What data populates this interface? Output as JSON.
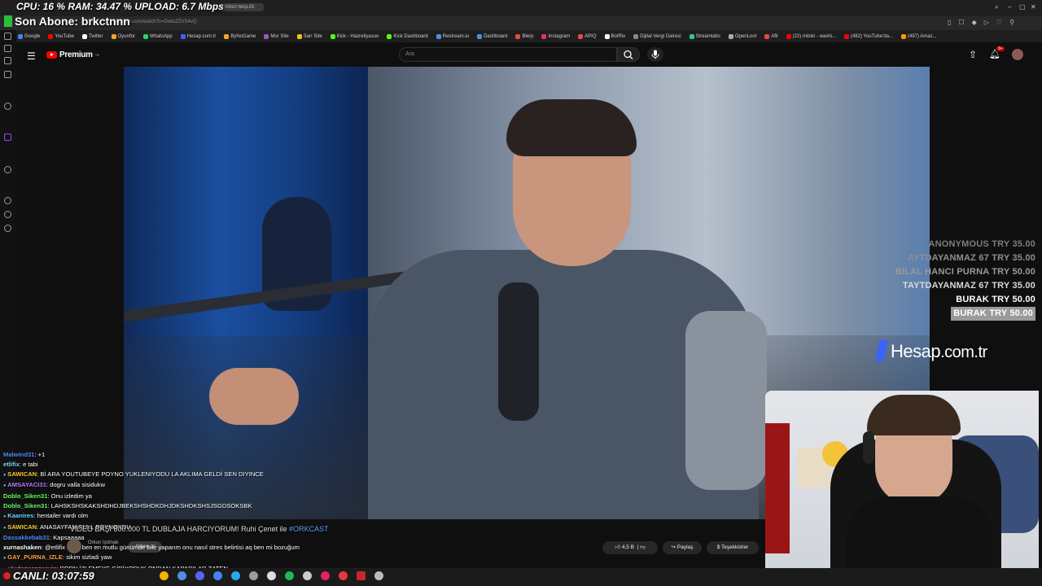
{
  "overlay": {
    "stats": "CPU: 16 % RAM:  34.47 % UPLOAD: 6.7 Mbps",
    "last_sub_prefix": "Son Abone:",
    "last_sub_name": "brkctnnn",
    "live_label": "CANLI:",
    "live_time": "03:07:59",
    "brand": "Hesap",
    "brand_suffix": ".com.tr"
  },
  "browser": {
    "url": "youtube.com/watch?v=DwtuZZVS4vQ",
    "tab_title": "VİDEO BAŞLIĞI",
    "bookmarks": [
      "Google",
      "YouTube",
      "Twitter",
      "Oyunfor",
      "WhatsApp",
      "Hesap.com.tr",
      "ByNoGame",
      "Mor Site",
      "Sarı Site",
      "Kick - Hazretiyasuo",
      "Kick Dashboard",
      "Restream.io",
      "Dashboard",
      "Blerp",
      "Instagram",
      "APIQ",
      "BotRix",
      "Dijital Vergi Dairesi",
      "Streamlabs",
      "OpenLoot",
      "Afil",
      "(22) mitski - washi...",
      "(482) YouTube'da...",
      "(497) Amaz..."
    ],
    "bookmark_colors": [
      "#4285f4",
      "#ff0000",
      "#ffffff",
      "#f5a623",
      "#25d366",
      "#3a63ff",
      "#f5a623",
      "#9b59b6",
      "#f1c40f",
      "#53fc18",
      "#53fc18",
      "#4a90e2",
      "#4a90e2",
      "#e74c3c",
      "#e1306c",
      "#e74c3c",
      "#ffffff",
      "#888888",
      "#31c3a2",
      "#aaaaaa",
      "#e74c3c",
      "#ff0000",
      "#ff0000",
      "#ff9900"
    ]
  },
  "youtube": {
    "logo_text": "Premium",
    "logo_sup": "TR",
    "search_placeholder": "Ara",
    "notif_count": "9+",
    "likes": "4,5 B",
    "share_label": "Paylaş",
    "thanks_label": "Teşekkürler",
    "subscribe_label": "Abone ol",
    "channel_sub": "Orkun Işıtmak"
  },
  "donations": [
    {
      "name": "ANONYMOUS",
      "amount": "TRY 35.00",
      "color": "#7d7d7d"
    },
    {
      "name": "AYTDAYANMAZ 67",
      "amount": "TRY 35.00",
      "color": "#8f8f8f"
    },
    {
      "name": "BILAL HANCI PURNA",
      "amount": "TRY 50.00",
      "color": "#9a9a9a"
    },
    {
      "name": "TAYTDAYANMAZ 67",
      "amount": "TRY 35.00",
      "color": "#d8d8d8"
    },
    {
      "name": "BURAK",
      "amount": "TRY 50.00",
      "color": "#ffffff"
    },
    {
      "name": "BURAK",
      "amount": "TRY 50.00",
      "color": "#ffffff",
      "highlight": true
    }
  ],
  "chat": [
    {
      "user": "Malwind31",
      "msg": "+1",
      "color": "#4f8cff",
      "badge": false
    },
    {
      "user": "etlifix",
      "msg": "e tabi",
      "color": "#7ad7ff",
      "badge": false
    },
    {
      "user": "SAWICAN",
      "msg": "Bİ ARA YOUTUBEYE POYNO YUKLENIYODU LA AKLIMA GELDİ SEN DIYINCE",
      "color": "#ffcc33",
      "badge": true
    },
    {
      "user": "AMSAYACI31",
      "msg": "dogru valla sisidukw",
      "color": "#b57bff",
      "badge": true
    },
    {
      "user": "Doblo_Siken31",
      "msg": "Onu izledim ya",
      "color": "#62ff62",
      "badge": false
    },
    {
      "user": "Doblo_Siken31",
      "msg": "LAHSKSHSKAKSHDHDJBEKSHSHDKDHJDKSHDKSHSJSGDSOKSBK",
      "color": "#62ff62",
      "badge": false
    },
    {
      "user": "Kaanires",
      "msg": "hentailer vardı olm",
      "color": "#66d9ff",
      "badge": true
    },
    {
      "user": "SAWICAN",
      "msg": "ANASAYFAM FULL POYNOYDU",
      "color": "#ffcc33",
      "badge": true
    },
    {
      "user": "Dassakkebab31",
      "msg": "Kapsaaaaa",
      "color": "#4f8cff",
      "badge": false
    },
    {
      "user": "xurnashaken",
      "msg": "@etlifix olum ben en mutlu günümde bile yaparım onu nasıl stres belirtisi aq ben mi bozuğum",
      "color": "#ffffff",
      "badge": false
    },
    {
      "user": "GAY_PURNA_IZLE",
      "msg": "sikim sizladi yaw",
      "color": "#ff9f43",
      "badge": true
    },
    {
      "user": "uludagazozseviz",
      "msg": "PORN İZLEMEYE GİRİYODUK ONDAN KAPADILAR ZATEN",
      "color": "#ff5e8a",
      "badge": true
    }
  ],
  "ticker": {
    "text": "VİDEO BAŞI 800.000 TL DUBLAJA HARCIYORUM! Ruhi Çenet ile",
    "tag": "#ORKCAST"
  },
  "taskbar_icons": [
    {
      "name": "chrome-icon",
      "color": "#f4b400"
    },
    {
      "name": "files-icon",
      "color": "#4a90e2"
    },
    {
      "name": "discord-icon",
      "color": "#5865f2"
    },
    {
      "name": "docs-icon",
      "color": "#4285f4"
    },
    {
      "name": "telegram-icon",
      "color": "#29a9eb"
    },
    {
      "name": "pin-icon",
      "color": "#9b9b9b"
    },
    {
      "name": "obs-icon",
      "color": "#dddddd"
    },
    {
      "name": "spotify-icon",
      "color": "#1db954"
    },
    {
      "name": "app-icon",
      "color": "#cccccc"
    },
    {
      "name": "red-app-icon",
      "color": "#e0245e"
    },
    {
      "name": "red-app-2-icon",
      "color": "#e53935"
    },
    {
      "name": "active-app-icon",
      "color": "#c62828"
    },
    {
      "name": "settings-icon",
      "color": "#bbbbbb"
    }
  ]
}
